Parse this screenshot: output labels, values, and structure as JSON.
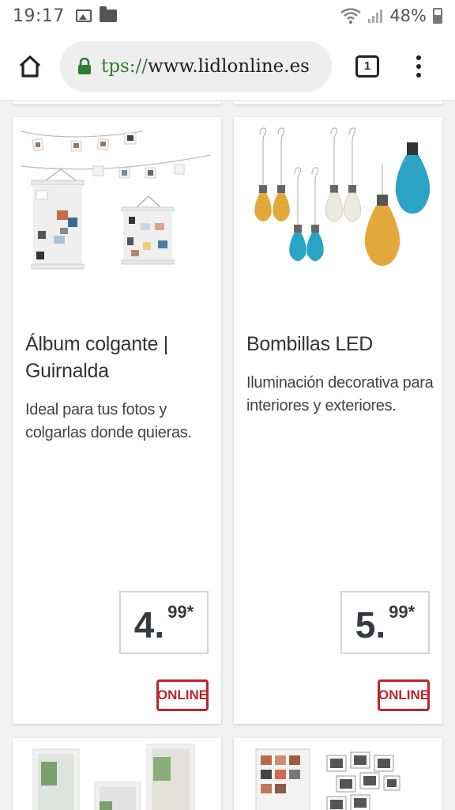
{
  "status_bar": {
    "time": "19:17",
    "battery": "48%"
  },
  "browser": {
    "url_scheme": "tps://",
    "url_host": "www.lidlonline.es",
    "tab_count": "1",
    "accent_color": "#2e7d32"
  },
  "products": [
    {
      "title": "Álbum colgante | Guirnalda",
      "description": "Ideal para tus fotos y colgarlas donde quieras.",
      "price_int": "4.",
      "price_dec": "99*",
      "badge": "ONLINE"
    },
    {
      "title": "Bombillas LED",
      "description": "Iluminación decorativa para interiores y exteriores.",
      "price_int": "5.",
      "price_dec": "99*",
      "badge": "ONLINE"
    }
  ],
  "colors": {
    "badge_red": "#c0242b",
    "bulb_yellow": "#e2a93a",
    "bulb_blue": "#2aa3c4",
    "bulb_white": "#ece9e0"
  }
}
